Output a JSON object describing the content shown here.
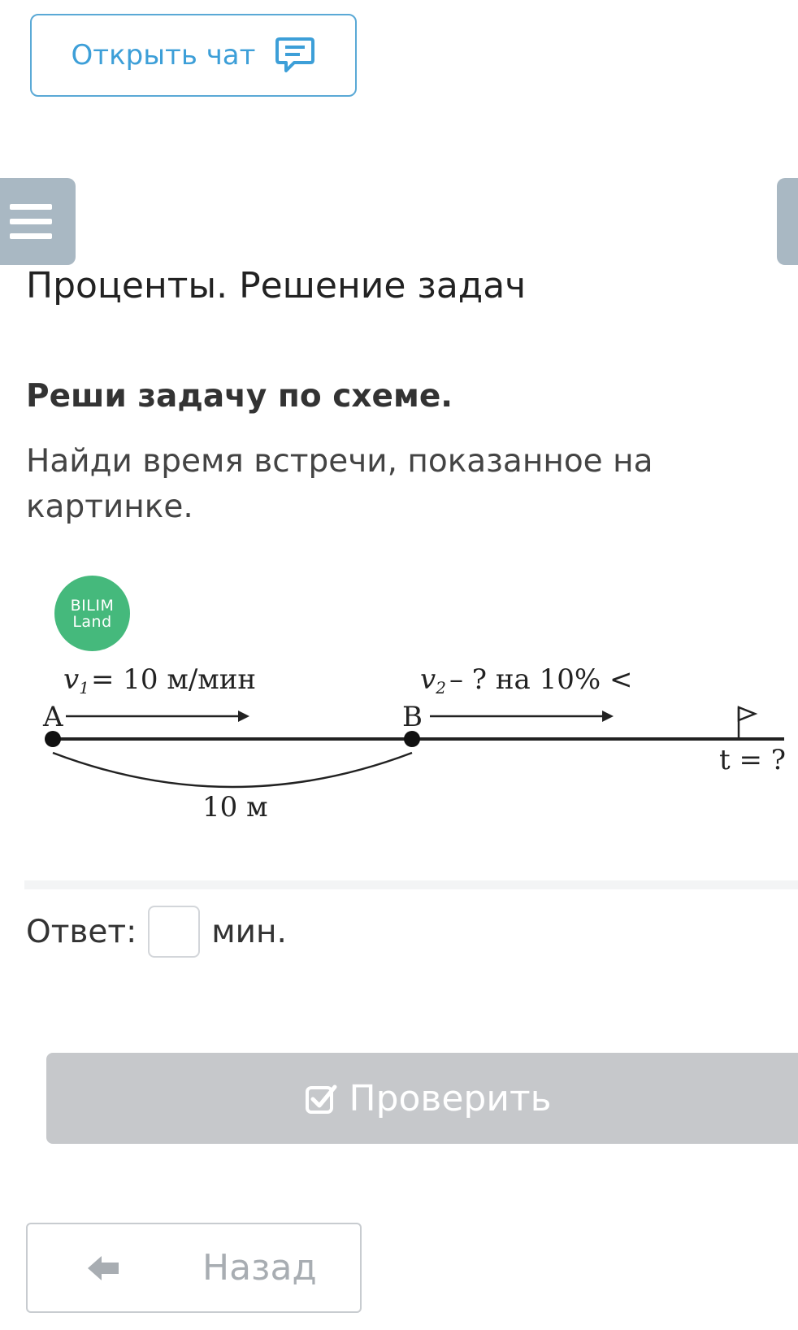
{
  "header": {
    "chat_button_label": "Открыть чат",
    "chat_icon": "chat-bubble-icon"
  },
  "nav": {
    "menu_icon": "hamburger-menu-icon"
  },
  "page": {
    "title": "Проценты. Решение задач"
  },
  "task": {
    "heading": "Реши задачу по схеме.",
    "text": "Найди время встречи, показанное на картинке."
  },
  "logo": {
    "line1": "BILIM",
    "line2": "Land",
    "color": "#45b97c"
  },
  "diagram": {
    "v1_label": "= 10 м/мин",
    "v2_label": "– ? на 10% <",
    "point_a": "A",
    "point_b": "B",
    "distance": "10 м",
    "time_label": "t = ?"
  },
  "answer": {
    "prefix": "Ответ:",
    "value": "",
    "unit": "мин."
  },
  "check_button": {
    "label": "Проверить",
    "icon": "check-square-icon",
    "color": "#c6c8cb"
  },
  "back_button": {
    "label": "Назад",
    "icon": "arrow-left-icon"
  },
  "colors": {
    "accent": "#3d9fd8",
    "tab": "#a9b8c3"
  }
}
